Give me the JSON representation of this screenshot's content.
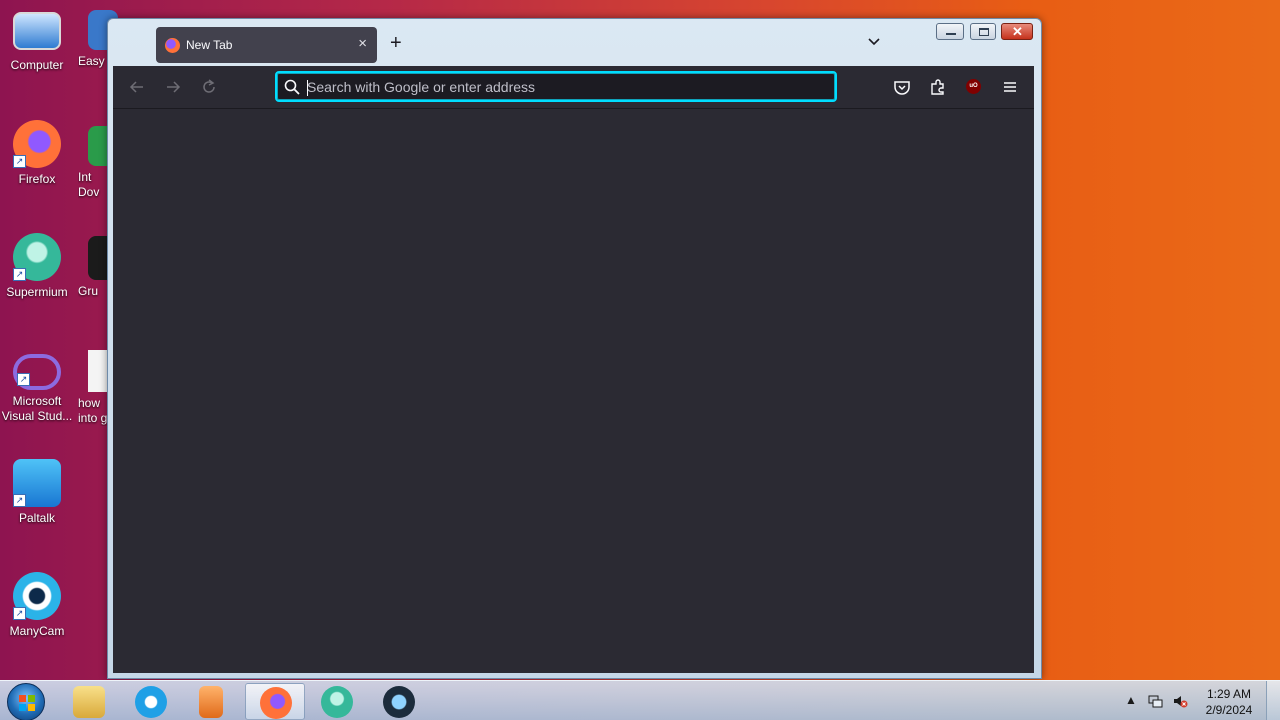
{
  "desktop": {
    "icons": [
      {
        "label": "Computer",
        "icon": "computer-icon"
      },
      {
        "label": "Firefox",
        "icon": "firefox-icon"
      },
      {
        "label": "Supermium",
        "icon": "supermium-icon"
      },
      {
        "label_line1": "Microsoft",
        "label_line2": "Visual Stud...",
        "icon": "visual-studio-icon"
      },
      {
        "label": "Paltalk",
        "icon": "paltalk-icon"
      },
      {
        "label": "ManyCam",
        "icon": "manycam-icon"
      }
    ],
    "partial_icons": [
      {
        "label": "Easy",
        "icon": "easy-icon"
      },
      {
        "label_line1": "Int",
        "label_line2": "Dov",
        "icon": "internet-download-icon"
      },
      {
        "label": "Gru",
        "icon": "gru-icon"
      },
      {
        "label_line1": "how",
        "label_line2": "into g",
        "icon": "document-icon"
      }
    ]
  },
  "browser": {
    "tab": {
      "title": "New Tab",
      "close": "×"
    },
    "new_tab_label": "+",
    "urlbar": {
      "placeholder": "Search with Google or enter address",
      "value": ""
    },
    "colors": {
      "chrome": "#2b2a33",
      "tab": "#42414d",
      "focus_ring": "#00ddff"
    }
  },
  "window_controls": {
    "close": "✕"
  },
  "taskbar": {
    "clock_time": "1:29 AM",
    "clock_date": "2/9/2024",
    "tray_chevron": "▲",
    "apps": [
      "file-explorer-icon",
      "internet-explorer-icon",
      "media-player-icon",
      "firefox-icon",
      "supermium-icon",
      "settings-app-icon"
    ]
  }
}
